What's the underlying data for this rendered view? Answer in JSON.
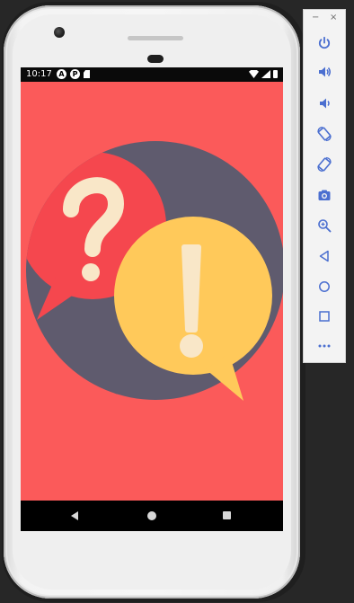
{
  "status_bar": {
    "time": "10:17",
    "left_icons": [
      "A",
      "P"
    ]
  },
  "emulator_toolbar": {
    "minimize_label": "−",
    "close_label": "×",
    "buttons": [
      {
        "icon": "power-icon"
      },
      {
        "icon": "volume-up-icon"
      },
      {
        "icon": "volume-down-icon"
      },
      {
        "icon": "rotate-left-icon"
      },
      {
        "icon": "rotate-right-icon"
      },
      {
        "icon": "camera-icon"
      },
      {
        "icon": "zoom-icon"
      },
      {
        "icon": "back-icon"
      },
      {
        "icon": "home-icon"
      },
      {
        "icon": "overview-icon"
      },
      {
        "icon": "more-icon"
      }
    ]
  },
  "navigation_bar": {
    "buttons": [
      "back",
      "home",
      "recents"
    ]
  },
  "colors": {
    "screen_background": "#fb5a5a",
    "circle": "#5f5b6e",
    "question_bubble": "#f5474e",
    "exclamation_bubble": "#ffc95a",
    "glyph": "#f9e7c8",
    "toolbar_icon": "#4b6fd0"
  }
}
